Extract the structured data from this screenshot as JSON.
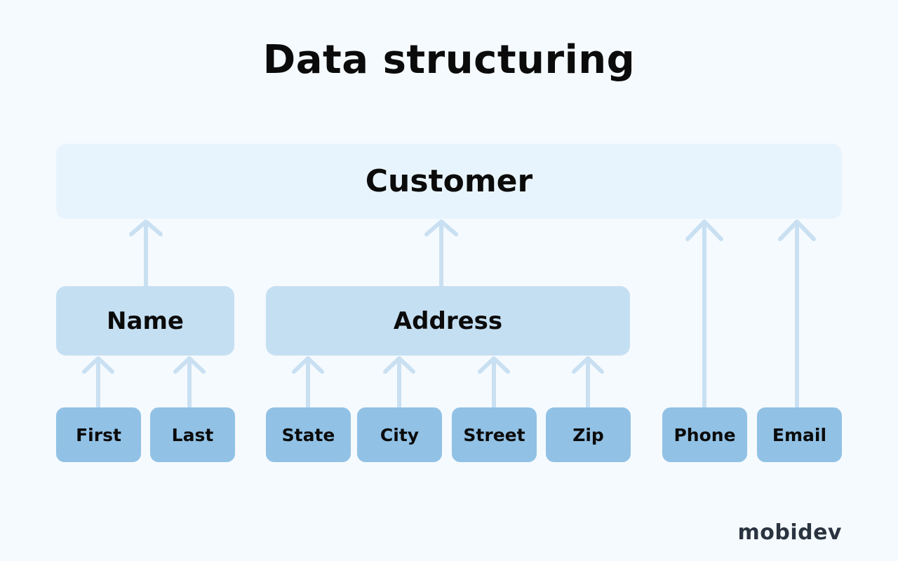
{
  "title": "Data structuring",
  "colors": {
    "background": "#F5FAFE",
    "root_box": "#E8F4FD",
    "group_box": "#C5DFF2",
    "leaf_box": "#91C1E5",
    "arrow": "#C9E0F2",
    "text": "#0B0B0B",
    "logo": "#2A3440"
  },
  "root": {
    "label": "Customer"
  },
  "groups": [
    {
      "id": "name",
      "label": "Name",
      "children": [
        "First",
        "Last"
      ]
    },
    {
      "id": "address",
      "label": "Address",
      "children": [
        "State",
        "City",
        "Street",
        "Zip"
      ]
    }
  ],
  "leaves": [
    {
      "label": "First",
      "parent": "Name"
    },
    {
      "label": "Last",
      "parent": "Name"
    },
    {
      "label": "State",
      "parent": "Address"
    },
    {
      "label": "City",
      "parent": "Address"
    },
    {
      "label": "Street",
      "parent": "Address"
    },
    {
      "label": "Zip",
      "parent": "Address"
    },
    {
      "label": "Phone",
      "parent": "Customer"
    },
    {
      "label": "Email",
      "parent": "Customer"
    }
  ],
  "logo": {
    "text": "mobidev"
  }
}
